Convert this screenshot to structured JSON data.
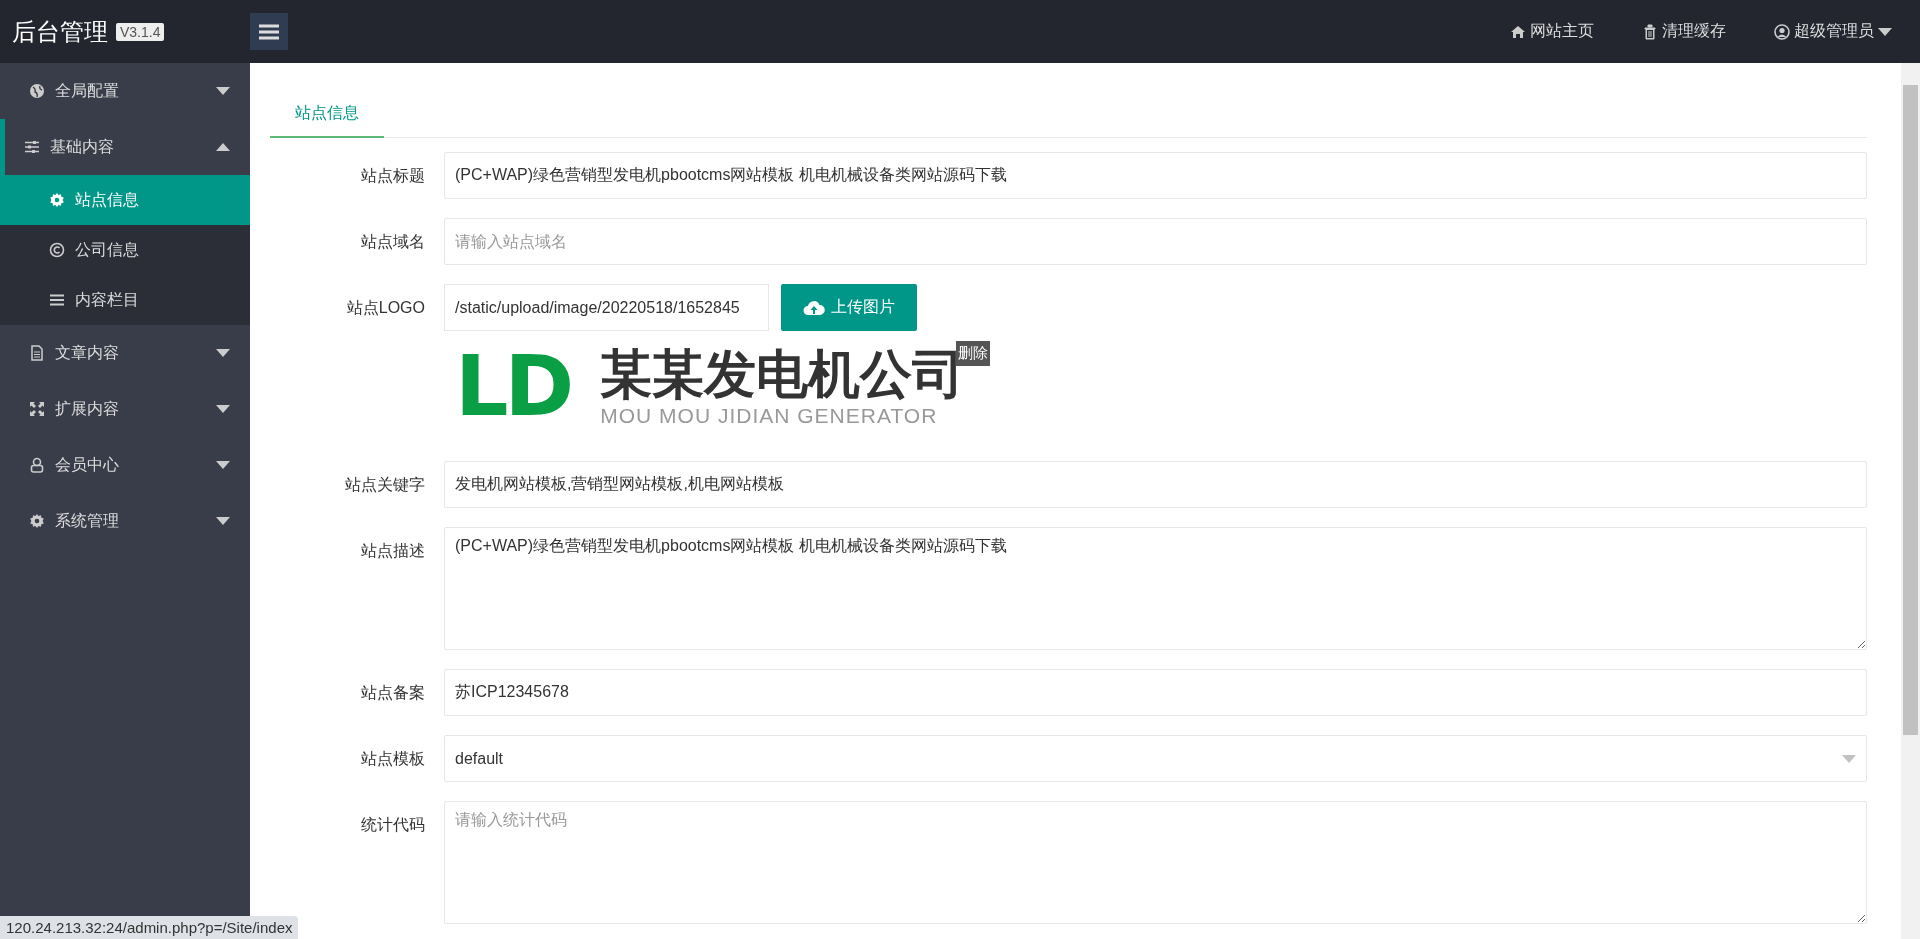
{
  "header": {
    "title": "后台管理",
    "version": "V3.1.4",
    "nav": [
      {
        "label": "网站主页",
        "dropdown": false
      },
      {
        "label": "清理缓存",
        "dropdown": false
      },
      {
        "label": "超级管理员",
        "dropdown": true
      }
    ]
  },
  "sidebar": {
    "items": [
      {
        "label": "全局配置",
        "expanded": false
      },
      {
        "label": "基础内容",
        "expanded": true,
        "children": [
          {
            "label": "站点信息",
            "selected": true
          },
          {
            "label": "公司信息",
            "selected": false
          },
          {
            "label": "内容栏目",
            "selected": false
          }
        ]
      },
      {
        "label": "文章内容",
        "expanded": false
      },
      {
        "label": "扩展内容",
        "expanded": false
      },
      {
        "label": "会员中心",
        "expanded": false
      },
      {
        "label": "系统管理",
        "expanded": false
      }
    ]
  },
  "tabs": [
    {
      "label": "站点信息",
      "selected": true
    }
  ],
  "form": {
    "fields": [
      {
        "kind": "text",
        "label": "站点标题",
        "value": "(PC+WAP)绿色营销型发电机pbootcms网站模板 机电机械设备类网站源码下载"
      },
      {
        "kind": "text",
        "label": "站点域名",
        "placeholder": "请输入站点域名"
      },
      {
        "kind": "upload",
        "label": "站点LOGO",
        "value": "/static/upload/image/20220518/1652845",
        "button": "上传图片",
        "preview": {
          "mark": "LD",
          "name": "某某发电机公司",
          "subtitle": "MOU MOU JIDIAN GENERATOR",
          "delete": "删除"
        }
      },
      {
        "kind": "text",
        "label": "站点关键字",
        "value": "发电机网站模板,营销型网站模板,机电网站模板"
      },
      {
        "kind": "textarea",
        "label": "站点描述",
        "value": "(PC+WAP)绿色营销型发电机pbootcms网站模板 机电机械设备类网站源码下载"
      },
      {
        "kind": "text",
        "label": "站点备案",
        "value": "苏ICP12345678"
      },
      {
        "kind": "select",
        "label": "站点模板",
        "value": "default"
      },
      {
        "kind": "textarea",
        "label": "统计代码",
        "placeholder": "请输入统计代码"
      }
    ]
  },
  "status_bar": {
    "url": "120.24.213.32:24/admin.php?p=/Site/index"
  }
}
